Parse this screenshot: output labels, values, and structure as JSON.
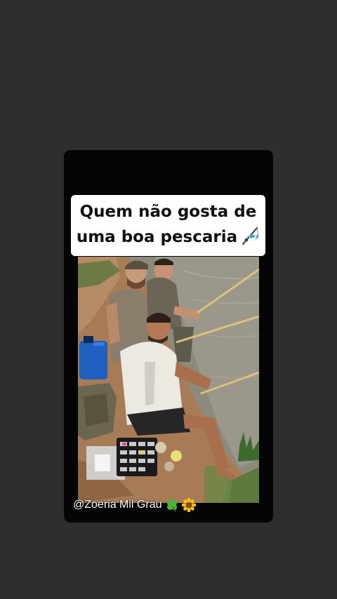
{
  "story": {
    "caption_line1": "Quem não gosta de",
    "caption_line2": "uma boa pescaria",
    "caption_emoji": "fishing-pole-icon",
    "watermark_text": "@Zoeria Mil Grau",
    "watermark_emojis": [
      "four-leaf-clover-icon",
      "sunflower-icon"
    ],
    "photo": {
      "description_icon": "photo-fishing-riverbank"
    }
  },
  "colors": {
    "background": "#2f2d2d",
    "card": "#050505",
    "caption_bg": "#ffffff",
    "caption_text": "#111111",
    "river": "#8f8b7c",
    "bank": "#a87d58"
  }
}
